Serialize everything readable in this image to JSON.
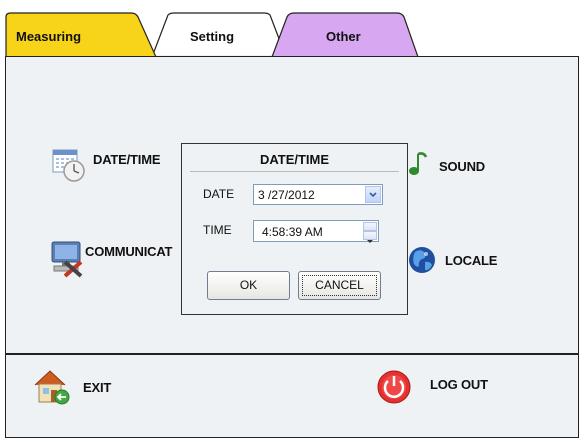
{
  "tabs": [
    {
      "label": "Measuring",
      "color": "#f7d31a"
    },
    {
      "label": "Setting",
      "color": "#ffffff"
    },
    {
      "label": "Other",
      "color": "#d7a7f2"
    }
  ],
  "settings": {
    "date_time": "DATE/TIME",
    "communication": "COMMUNICAT",
    "sound": "SOUND",
    "locale": "LOCALE"
  },
  "dialog": {
    "title": "DATE/TIME",
    "date_label": "DATE",
    "date_value": "3 /27/2012",
    "time_label": "TIME",
    "time_value": "4:58:39 AM",
    "ok_label": "OK",
    "cancel_label": "CANCEL"
  },
  "bottom": {
    "exit_label": "EXIT",
    "logout_label": "LOG OUT"
  },
  "icons": {
    "date_time": "calendar-clock-icon",
    "communication": "computer-network-icon",
    "sound": "music-note-icon",
    "locale": "globe-icon",
    "exit": "house-icon",
    "logout": "power-icon"
  }
}
